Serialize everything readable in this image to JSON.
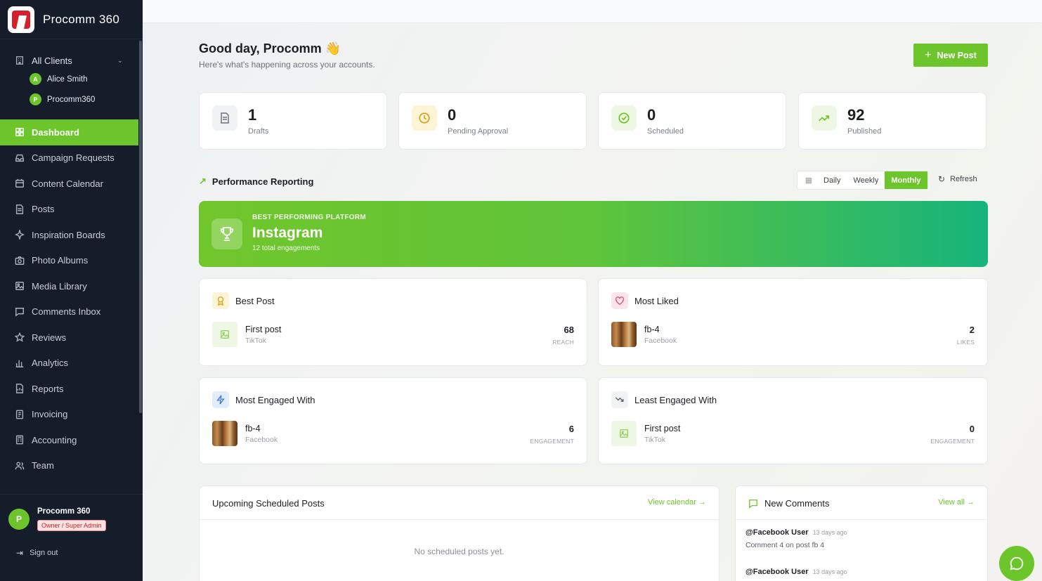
{
  "app": {
    "name": "Procomm 360"
  },
  "sidebar": {
    "client_selector": "All Clients",
    "clients": [
      {
        "initial": "A",
        "name": "Alice Smith"
      },
      {
        "initial": "P",
        "name": "Procomm360"
      }
    ],
    "items": [
      {
        "label": "Dashboard",
        "icon": "grid-icon",
        "active": true
      },
      {
        "label": "Campaign Requests",
        "icon": "inbox-icon"
      },
      {
        "label": "Content Calendar",
        "icon": "calendar-icon"
      },
      {
        "label": "Posts",
        "icon": "document-icon"
      },
      {
        "label": "Inspiration Boards",
        "icon": "sparkle-icon"
      },
      {
        "label": "Photo Albums",
        "icon": "camera-icon"
      },
      {
        "label": "Media Library",
        "icon": "image-icon"
      },
      {
        "label": "Comments Inbox",
        "icon": "chat-icon"
      },
      {
        "label": "Reviews",
        "icon": "star-icon"
      },
      {
        "label": "Analytics",
        "icon": "bar-chart-icon"
      },
      {
        "label": "Reports",
        "icon": "report-icon"
      },
      {
        "label": "Invoicing",
        "icon": "invoice-icon"
      },
      {
        "label": "Accounting",
        "icon": "accounting-icon"
      },
      {
        "label": "Team",
        "icon": "users-icon"
      }
    ],
    "user": {
      "initial": "P",
      "name": "Procomm 360",
      "role": "Owner / Super Admin"
    },
    "signout": "Sign out"
  },
  "header": {
    "greeting": "Good day, Procomm",
    "greeting_emoji": "👋",
    "subtitle": "Here's what's happening across your accounts.",
    "new_post": "New Post"
  },
  "stats": [
    {
      "value": "1",
      "label": "Drafts",
      "icon": "document-icon",
      "bg": "#f1f2f4",
      "fg": "#6d737c"
    },
    {
      "value": "0",
      "label": "Pending Approval",
      "icon": "clock-icon",
      "bg": "#fdf3d6",
      "fg": "#d9a21b"
    },
    {
      "value": "0",
      "label": "Scheduled",
      "icon": "check-circle-icon",
      "bg": "#eef7e4",
      "fg": "#6cc52a"
    },
    {
      "value": "92",
      "label": "Published",
      "icon": "trend-up-icon",
      "bg": "#eef7e4",
      "fg": "#6cc52a"
    }
  ],
  "performance": {
    "title": "Performance Reporting",
    "periods": [
      "Daily",
      "Weekly",
      "Monthly"
    ],
    "selected_period": "Monthly",
    "refresh": "Refresh",
    "best_platform": {
      "label": "BEST PERFORMING PLATFORM",
      "name": "Instagram",
      "engagements": "12 total engagements"
    }
  },
  "highlights": [
    {
      "title": "Best Post",
      "icon": "award-icon",
      "post": "First post",
      "platform": "TikTok",
      "metric_value": "68",
      "metric_label": "REACH",
      "thumb": "placeholder"
    },
    {
      "title": "Most Liked",
      "icon": "heart-icon",
      "post": "fb-4",
      "platform": "Facebook",
      "metric_value": "2",
      "metric_label": "LIKES",
      "thumb": "photo"
    },
    {
      "title": "Most Engaged With",
      "icon": "lightning-icon",
      "post": "fb-4",
      "platform": "Facebook",
      "metric_value": "6",
      "metric_label": "ENGAGEMENT",
      "thumb": "photo"
    },
    {
      "title": "Least Engaged With",
      "icon": "trend-down-icon",
      "post": "First post",
      "platform": "TikTok",
      "metric_value": "0",
      "metric_label": "ENGAGEMENT",
      "thumb": "placeholder"
    }
  ],
  "upcoming": {
    "title": "Upcoming Scheduled Posts",
    "link": "View calendar →",
    "empty": "No scheduled posts yet."
  },
  "comments": {
    "title": "New Comments",
    "link": "View all →",
    "items": [
      {
        "user": "@Facebook User",
        "time": "13 days ago",
        "text": "Comment 4 on post fb 4"
      },
      {
        "user": "@Facebook User",
        "time": "13 days ago",
        "text": ""
      }
    ]
  },
  "colors": {
    "accent": "#6cc52a",
    "sidebar": "#151c2a",
    "brand_red": "#d3202a"
  }
}
